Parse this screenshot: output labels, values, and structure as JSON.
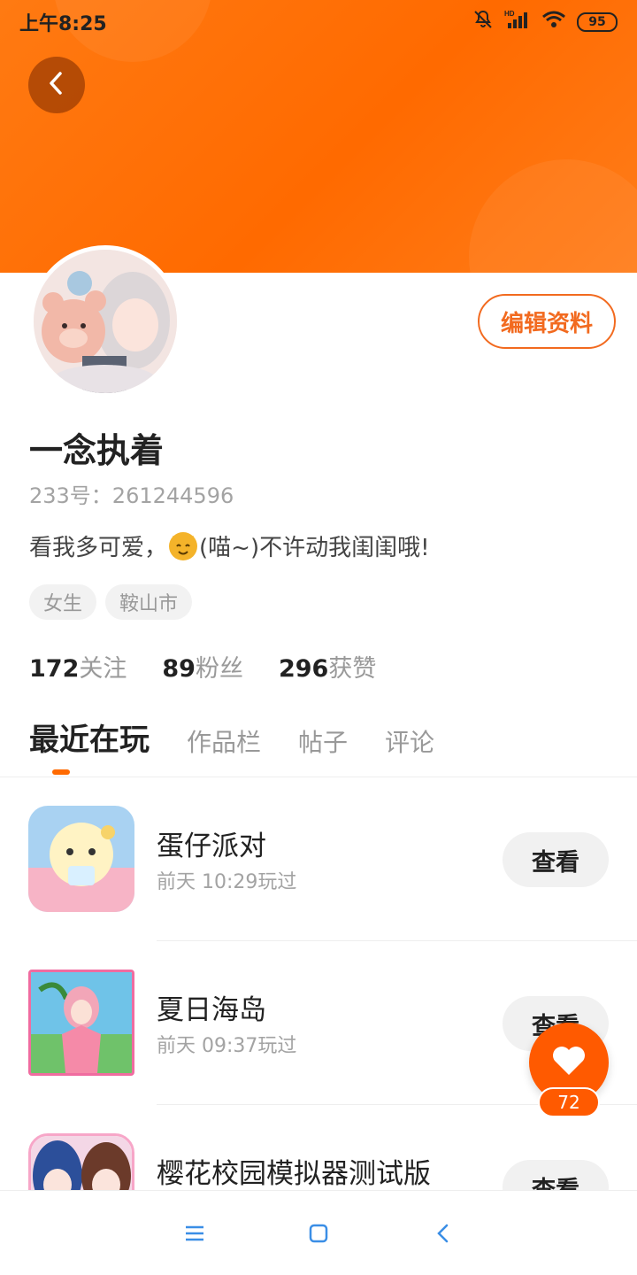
{
  "status_bar": {
    "time": "上午8:25",
    "battery": "95",
    "network": "HD"
  },
  "profile": {
    "edit_label": "编辑资料",
    "username": "一念执着",
    "id_text": "233号：261244596",
    "bio_before": "看我多可爱，",
    "bio_after": "(喵~)不许动我闺闺哦!",
    "tags": [
      "女生",
      "鞍山市"
    ],
    "stats": [
      {
        "num": "172",
        "label": "关注"
      },
      {
        "num": "89",
        "label": "粉丝"
      },
      {
        "num": "296",
        "label": "获赞"
      }
    ]
  },
  "tabs": [
    "最近在玩",
    "作品栏",
    "帖子",
    "评论"
  ],
  "games": [
    {
      "name": "蛋仔派对",
      "time": "前天 10:29玩过",
      "button": "查看",
      "icon": "egg-party-icon"
    },
    {
      "name": "夏日海岛",
      "time": "前天 09:37玩过",
      "button": "查看",
      "icon": "summer-island-icon"
    },
    {
      "name": "樱花校园模拟器测试版",
      "time": "",
      "button": "查看",
      "icon": "sakura-school-icon"
    }
  ],
  "fab": {
    "count": "72"
  },
  "colors": {
    "accent": "#ff6a00",
    "header": "#ff7a12",
    "button_bg": "#f1f1f1"
  }
}
